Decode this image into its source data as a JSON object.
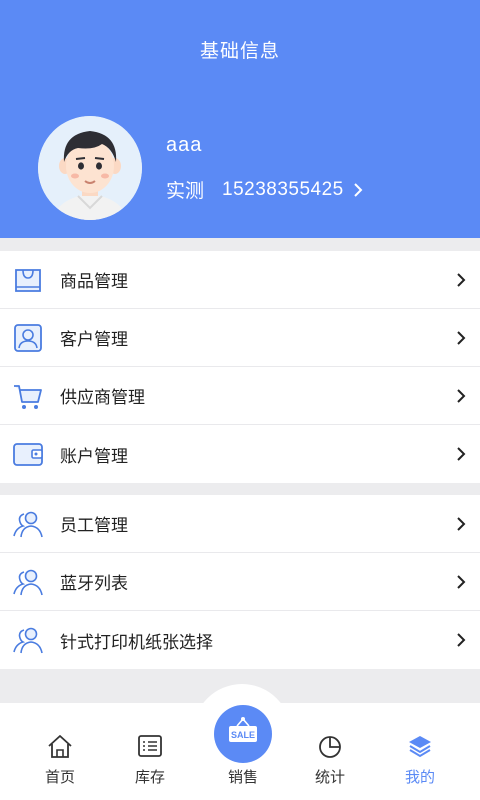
{
  "header": {
    "title": "基础信息",
    "username": "aaa",
    "role": "实测",
    "phone": "15238355425"
  },
  "menu_group_1": [
    {
      "label": "商品管理",
      "icon": "shopping-bag-icon"
    },
    {
      "label": "客户管理",
      "icon": "customer-card-icon"
    },
    {
      "label": "供应商管理",
      "icon": "cart-icon"
    },
    {
      "label": "账户管理",
      "icon": "wallet-icon"
    }
  ],
  "menu_group_2": [
    {
      "label": "员工管理",
      "icon": "users-icon"
    },
    {
      "label": "蓝牙列表",
      "icon": "users-icon"
    },
    {
      "label": "针式打印机纸张选择",
      "icon": "users-icon"
    }
  ],
  "tabbar": {
    "home": "首页",
    "inventory": "库存",
    "sales": "销售",
    "sale_badge": "SALE",
    "stats": "统计",
    "mine": "我的"
  },
  "colors": {
    "accent": "#5b8af5",
    "icon_stroke": "#4a7ce0"
  }
}
